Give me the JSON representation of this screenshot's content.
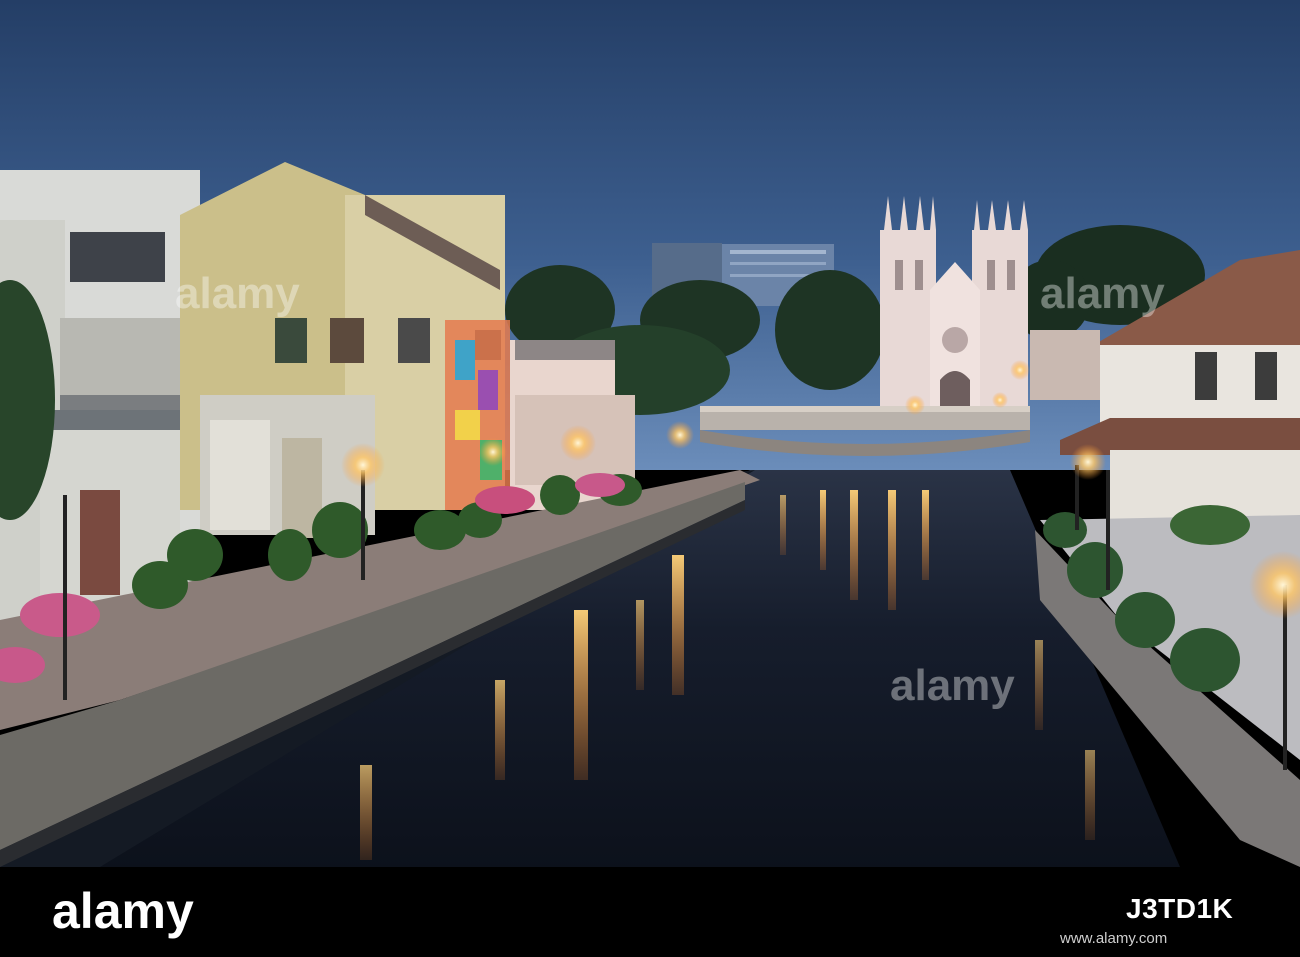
{
  "photo": {
    "alt_subject": "canal-at-dusk",
    "colors": {
      "sky_top": "#2b4770",
      "sky_bottom": "#5a7fad",
      "water": "#141b2a",
      "lamp_glow": "#ffb347"
    }
  },
  "watermark": {
    "brand": "alamy",
    "image_id": "J3TD1K",
    "url": "www.alamy.com"
  }
}
